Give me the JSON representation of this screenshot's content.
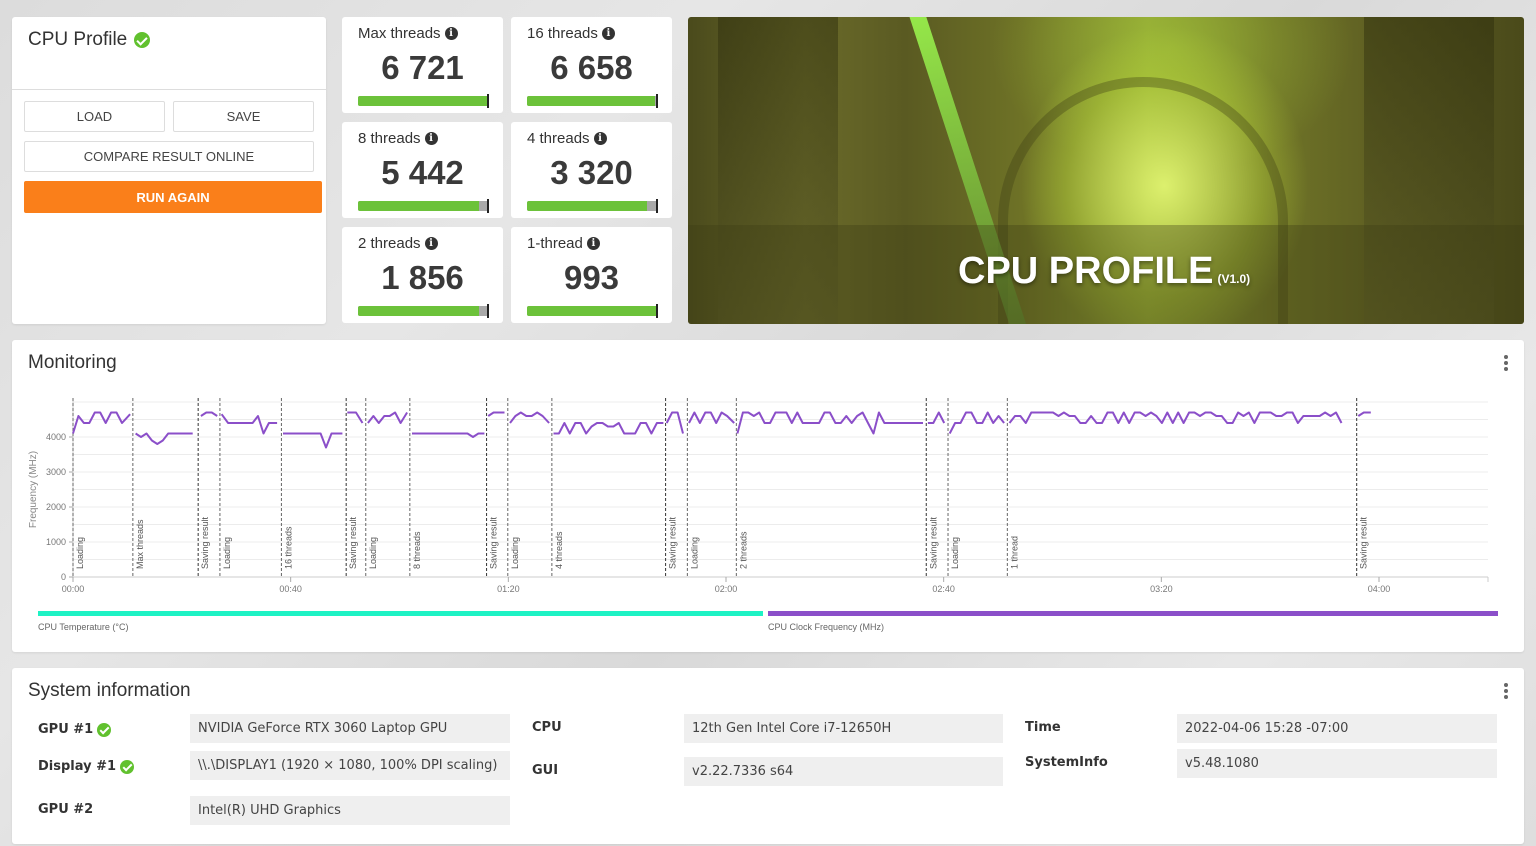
{
  "profile": {
    "title": "CPU Profile",
    "status_icon": "check-circle-icon",
    "buttons": {
      "load": "LOAD",
      "save": "SAVE",
      "compare": "COMPARE RESULT ONLINE",
      "run_again": "RUN AGAIN"
    }
  },
  "scores": [
    {
      "label": "Max threads",
      "value": "6 721",
      "bar_fraction": 1.0
    },
    {
      "label": "16 threads",
      "value": "6 658",
      "bar_fraction": 0.99
    },
    {
      "label": "8 threads",
      "value": "5 442",
      "bar_fraction": 0.94
    },
    {
      "label": "4 threads",
      "value": "3 320",
      "bar_fraction": 0.93
    },
    {
      "label": "2 threads",
      "value": "1 856",
      "bar_fraction": 0.94
    },
    {
      "label": "1-thread",
      "value": "993",
      "bar_fraction": 1.0
    }
  ],
  "banner": {
    "title": "CPU PROFILE",
    "version": "(V1.0)"
  },
  "monitoring": {
    "title": "Monitoring",
    "legend": [
      {
        "label": "CPU Temperature (°C)",
        "color": "#1ef2c4"
      },
      {
        "label": "CPU Clock Frequency (MHz)",
        "color": "#8b4fc9"
      }
    ]
  },
  "chart_data": {
    "type": "line",
    "title": "",
    "xlabel": "",
    "ylabel": "Frequency (MHz)",
    "xlim_seconds": [
      0,
      260
    ],
    "ylim": [
      0,
      5000
    ],
    "yticks": [
      0,
      1000,
      2000,
      3000,
      4000
    ],
    "ytick_labels": [
      "0",
      "1000",
      "2000",
      "3000",
      "4000"
    ],
    "xticks_seconds": [
      0,
      40,
      80,
      120,
      160,
      200,
      240
    ],
    "xtick_labels": [
      "00:00",
      "00:40",
      "01:20",
      "02:00",
      "02:40",
      "03:20",
      "04:00"
    ],
    "grid": true,
    "series_color": "#8b4fc9",
    "markers": [
      {
        "t": 0,
        "label": "Loading"
      },
      {
        "t": 11,
        "label": "Max threads"
      },
      {
        "t": 23,
        "label": "Saving result"
      },
      {
        "t": 27,
        "label": "Loading"
      },
      {
        "t": 38.3,
        "label": "16 threads"
      },
      {
        "t": 50.2,
        "label": "Saving result"
      },
      {
        "t": 53.8,
        "label": "Loading"
      },
      {
        "t": 61.9,
        "label": "8 threads"
      },
      {
        "t": 76,
        "label": "Saving result"
      },
      {
        "t": 79.9,
        "label": "Loading"
      },
      {
        "t": 88,
        "label": "4 threads"
      },
      {
        "t": 108.9,
        "label": "Saving result"
      },
      {
        "t": 112.9,
        "label": "Loading"
      },
      {
        "t": 121.9,
        "label": "2 threads"
      },
      {
        "t": 156.8,
        "label": "Saving result"
      },
      {
        "t": 160.8,
        "label": "Loading"
      },
      {
        "t": 171.7,
        "label": "1 thread"
      },
      {
        "t": 235.9,
        "label": "Saving result"
      }
    ],
    "segments": [
      {
        "name": "Loading",
        "points": [
          [
            0,
            4100
          ],
          [
            1,
            4600
          ],
          [
            2,
            4400
          ],
          [
            3,
            4400
          ],
          [
            4,
            4700
          ],
          [
            5,
            4700
          ],
          [
            6,
            4400
          ],
          [
            7,
            4700
          ],
          [
            8,
            4700
          ],
          [
            9,
            4400
          ],
          [
            10.5,
            4650
          ]
        ]
      },
      {
        "name": "Max threads",
        "points": [
          [
            11.5,
            4100
          ],
          [
            12.5,
            4000
          ],
          [
            13.5,
            4100
          ],
          [
            14.5,
            3900
          ],
          [
            15.5,
            3800
          ],
          [
            16.5,
            3900
          ],
          [
            17.5,
            4100
          ],
          [
            18.5,
            4100
          ],
          [
            20,
            4100
          ],
          [
            22,
            4100
          ]
        ]
      },
      {
        "name": "Saving result",
        "points": [
          [
            23.5,
            4600
          ],
          [
            24.5,
            4700
          ],
          [
            25.5,
            4700
          ],
          [
            26.5,
            4600
          ]
        ]
      },
      {
        "name": "Loading",
        "points": [
          [
            27.3,
            4650
          ],
          [
            28.5,
            4400
          ],
          [
            30,
            4400
          ],
          [
            32,
            4400
          ],
          [
            33,
            4400
          ],
          [
            34,
            4600
          ],
          [
            35,
            4100
          ],
          [
            36,
            4400
          ],
          [
            37.5,
            4400
          ]
        ]
      },
      {
        "name": "16 threads",
        "points": [
          [
            38.6,
            4100
          ],
          [
            40,
            4100
          ],
          [
            42,
            4100
          ],
          [
            44,
            4100
          ],
          [
            45.5,
            4100
          ],
          [
            46.5,
            3700
          ],
          [
            47.5,
            4100
          ],
          [
            49.5,
            4100
          ]
        ]
      },
      {
        "name": "Saving result",
        "points": [
          [
            50.4,
            4700
          ],
          [
            52,
            4700
          ],
          [
            53.2,
            4400
          ]
        ]
      },
      {
        "name": "Loading",
        "points": [
          [
            54.2,
            4400
          ],
          [
            55.2,
            4600
          ],
          [
            56.2,
            4400
          ],
          [
            57.2,
            4600
          ],
          [
            58.2,
            4600
          ],
          [
            59.2,
            4700
          ],
          [
            60.2,
            4400
          ],
          [
            61.4,
            4700
          ]
        ]
      },
      {
        "name": "8 threads",
        "points": [
          [
            62.3,
            4100
          ],
          [
            66,
            4100
          ],
          [
            70,
            4100
          ],
          [
            72.5,
            4100
          ],
          [
            73.5,
            4000
          ],
          [
            74.5,
            4100
          ],
          [
            75.6,
            4100
          ]
        ]
      },
      {
        "name": "Saving result",
        "points": [
          [
            76.3,
            4600
          ],
          [
            77.3,
            4700
          ],
          [
            79.3,
            4700
          ]
        ]
      },
      {
        "name": "Loading",
        "points": [
          [
            80.3,
            4400
          ],
          [
            81.3,
            4600
          ],
          [
            82.3,
            4700
          ],
          [
            83.3,
            4600
          ],
          [
            84.3,
            4600
          ],
          [
            85.3,
            4700
          ],
          [
            86.3,
            4600
          ],
          [
            87.5,
            4400
          ]
        ]
      },
      {
        "name": "4 threads",
        "points": [
          [
            88.3,
            4100
          ],
          [
            89.3,
            4100
          ],
          [
            90.3,
            4400
          ],
          [
            91.3,
            4100
          ],
          [
            92.3,
            4400
          ],
          [
            93.3,
            4400
          ],
          [
            94.3,
            4100
          ],
          [
            95.3,
            4300
          ],
          [
            96.3,
            4400
          ],
          [
            97.3,
            4400
          ],
          [
            98.3,
            4300
          ],
          [
            99.3,
            4300
          ],
          [
            100.3,
            4400
          ],
          [
            101.3,
            4100
          ],
          [
            103.3,
            4100
          ],
          [
            104.3,
            4400
          ],
          [
            105.3,
            4400
          ],
          [
            106.3,
            4100
          ],
          [
            107.3,
            4400
          ],
          [
            108.5,
            4400
          ]
        ]
      },
      {
        "name": "Saving result",
        "points": [
          [
            109.1,
            4400
          ],
          [
            110.1,
            4700
          ],
          [
            111.1,
            4700
          ],
          [
            112.1,
            4100
          ]
        ]
      },
      {
        "name": "Loading",
        "points": [
          [
            113.2,
            4400
          ],
          [
            114.2,
            4700
          ],
          [
            115.2,
            4400
          ],
          [
            116.2,
            4700
          ],
          [
            117.2,
            4700
          ],
          [
            118.2,
            4400
          ],
          [
            119.2,
            4700
          ],
          [
            120.2,
            4600
          ],
          [
            121.5,
            4400
          ]
        ]
      },
      {
        "name": "2 threads",
        "points": [
          [
            122.1,
            4100
          ],
          [
            123.1,
            4700
          ],
          [
            124.1,
            4700
          ],
          [
            125.1,
            4600
          ],
          [
            126.1,
            4700
          ],
          [
            127.1,
            4400
          ],
          [
            128.1,
            4400
          ],
          [
            129.1,
            4700
          ],
          [
            130.1,
            4700
          ],
          [
            131.1,
            4700
          ],
          [
            132.1,
            4400
          ],
          [
            133.1,
            4700
          ],
          [
            134.1,
            4400
          ],
          [
            135.1,
            4400
          ],
          [
            136.1,
            4400
          ],
          [
            137.1,
            4400
          ],
          [
            138.1,
            4700
          ],
          [
            139.1,
            4700
          ],
          [
            140.1,
            4400
          ],
          [
            141.1,
            4400
          ],
          [
            142.1,
            4600
          ],
          [
            143.1,
            4400
          ],
          [
            144.1,
            4600
          ],
          [
            145.1,
            4700
          ],
          [
            146.1,
            4400
          ],
          [
            147.1,
            4100
          ],
          [
            148.1,
            4700
          ],
          [
            149.1,
            4400
          ],
          [
            150.1,
            4400
          ],
          [
            152.1,
            4400
          ],
          [
            153.1,
            4400
          ],
          [
            154.1,
            4400
          ],
          [
            156.2,
            4400
          ]
        ]
      },
      {
        "name": "Saving result",
        "points": [
          [
            157.1,
            4400
          ],
          [
            158.1,
            4400
          ],
          [
            159.1,
            4700
          ],
          [
            160.1,
            4400
          ]
        ]
      },
      {
        "name": "Loading",
        "points": [
          [
            161.1,
            4100
          ],
          [
            162.1,
            4400
          ],
          [
            163.1,
            4400
          ],
          [
            164.1,
            4700
          ],
          [
            165.1,
            4700
          ],
          [
            166.1,
            4400
          ],
          [
            167.1,
            4400
          ],
          [
            168.1,
            4700
          ],
          [
            169.1,
            4400
          ],
          [
            170.1,
            4600
          ],
          [
            171.1,
            4400
          ]
        ]
      },
      {
        "name": "1 thread",
        "points": [
          [
            172.1,
            4400
          ],
          [
            173.1,
            4600
          ],
          [
            174.1,
            4600
          ],
          [
            175.1,
            4400
          ],
          [
            176.1,
            4700
          ],
          [
            178.1,
            4700
          ],
          [
            180.1,
            4700
          ],
          [
            181.1,
            4600
          ],
          [
            182.1,
            4700
          ],
          [
            183.1,
            4600
          ],
          [
            184.1,
            4600
          ],
          [
            185.1,
            4400
          ],
          [
            186.1,
            4400
          ],
          [
            187.1,
            4600
          ],
          [
            188.1,
            4400
          ],
          [
            189.1,
            4400
          ],
          [
            190.1,
            4700
          ],
          [
            191.1,
            4700
          ],
          [
            192.1,
            4400
          ],
          [
            193.1,
            4700
          ],
          [
            194.1,
            4400
          ],
          [
            195.1,
            4700
          ],
          [
            196.1,
            4700
          ],
          [
            197.1,
            4600
          ],
          [
            198.1,
            4700
          ],
          [
            199.1,
            4600
          ],
          [
            200.1,
            4400
          ],
          [
            201.1,
            4700
          ],
          [
            202.1,
            4400
          ],
          [
            203.1,
            4700
          ],
          [
            204.1,
            4400
          ],
          [
            205.1,
            4700
          ],
          [
            206.1,
            4700
          ],
          [
            207.1,
            4600
          ],
          [
            208.1,
            4700
          ],
          [
            209.1,
            4700
          ],
          [
            210.1,
            4600
          ],
          [
            211.1,
            4600
          ],
          [
            212.1,
            4400
          ],
          [
            213.1,
            4400
          ],
          [
            214.1,
            4700
          ],
          [
            215.1,
            4600
          ],
          [
            216.1,
            4700
          ],
          [
            217.1,
            4400
          ],
          [
            218.1,
            4700
          ],
          [
            219.1,
            4700
          ],
          [
            220.1,
            4700
          ],
          [
            221.1,
            4600
          ],
          [
            222.1,
            4600
          ],
          [
            223.1,
            4700
          ],
          [
            224.1,
            4700
          ],
          [
            225.1,
            4400
          ],
          [
            226.1,
            4600
          ],
          [
            227.1,
            4600
          ],
          [
            228.1,
            4600
          ],
          [
            229.1,
            4600
          ],
          [
            230.1,
            4700
          ],
          [
            231.1,
            4600
          ],
          [
            232.1,
            4700
          ],
          [
            233.1,
            4400
          ]
        ]
      },
      {
        "name": "Saving result",
        "points": [
          [
            236.2,
            4600
          ],
          [
            237.2,
            4700
          ],
          [
            238.5,
            4700
          ]
        ]
      }
    ]
  },
  "system_info": {
    "title": "System information",
    "rows": {
      "gpu1": {
        "label": "GPU #1",
        "value": "NVIDIA GeForce RTX 3060 Laptop GPU",
        "verified": true
      },
      "display1": {
        "label": "Display #1",
        "value": "\\\\.\\DISPLAY1 (1920 × 1080, 100% DPI scaling)",
        "verified": true
      },
      "gpu2": {
        "label": "GPU #2",
        "value": "Intel(R) UHD Graphics"
      },
      "cpu": {
        "label": "CPU",
        "value": "12th Gen Intel Core i7-12650H"
      },
      "gui": {
        "label": "GUI",
        "value": "v2.22.7336 s64"
      },
      "time": {
        "label": "Time",
        "value": "2022-04-06 15:28 -07:00"
      },
      "systeminfo": {
        "label": "SystemInfo",
        "value": "v5.48.1080"
      }
    }
  }
}
